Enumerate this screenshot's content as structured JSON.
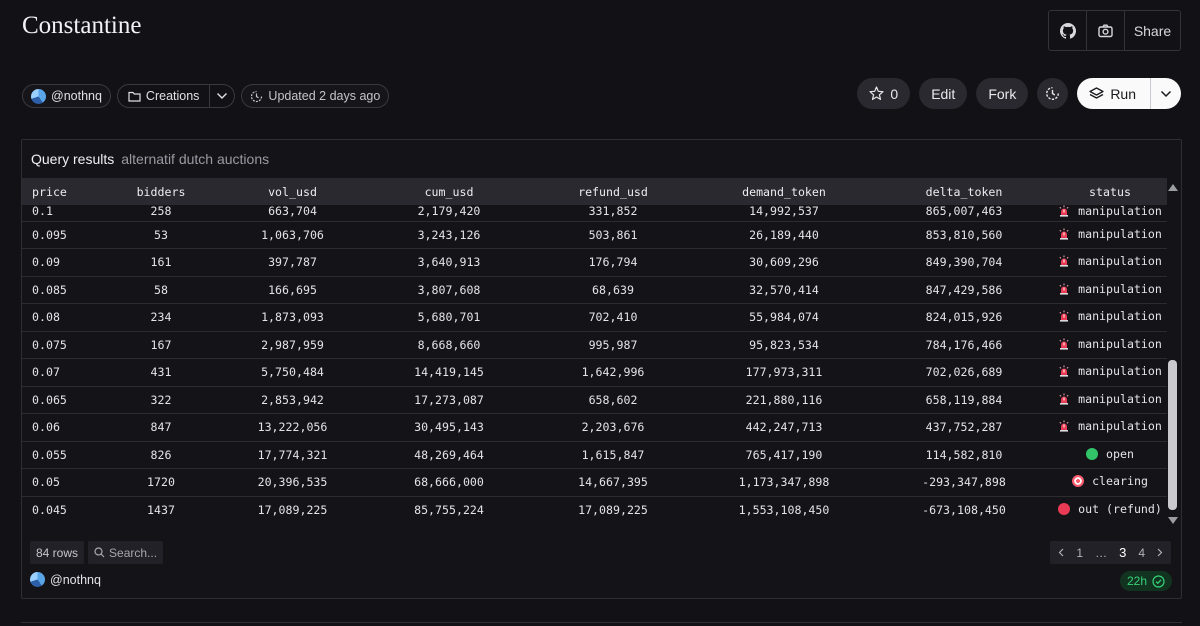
{
  "page": {
    "title": "Constantine"
  },
  "topbar": {
    "share_label": "Share",
    "github_icon": "github-icon",
    "camera_icon": "camera-icon"
  },
  "meta": {
    "author": "@nothnq",
    "folder": "Creations",
    "updated": "Updated 2 days ago"
  },
  "actions": {
    "star_count": "0",
    "edit_label": "Edit",
    "fork_label": "Fork",
    "run_label": "Run"
  },
  "query": {
    "heading": "Query results",
    "name": "alternatif dutch auctions"
  },
  "table": {
    "columns": [
      "price",
      "bidders",
      "vol_usd",
      "cum_usd",
      "refund_usd",
      "demand_token",
      "delta_token",
      "status"
    ],
    "rows": [
      [
        "0.1",
        "258",
        "663,704",
        "2,179,420",
        "331,852",
        "14,992,537",
        "865,007,463",
        "manipulation"
      ],
      [
        "0.095",
        "53",
        "1,063,706",
        "3,243,126",
        "503,861",
        "26,189,440",
        "853,810,560",
        "manipulation"
      ],
      [
        "0.09",
        "161",
        "397,787",
        "3,640,913",
        "176,794",
        "30,609,296",
        "849,390,704",
        "manipulation"
      ],
      [
        "0.085",
        "58",
        "166,695",
        "3,807,608",
        "68,639",
        "32,570,414",
        "847,429,586",
        "manipulation"
      ],
      [
        "0.08",
        "234",
        "1,873,093",
        "5,680,701",
        "702,410",
        "55,984,074",
        "824,015,926",
        "manipulation"
      ],
      [
        "0.075",
        "167",
        "2,987,959",
        "8,668,660",
        "995,987",
        "95,823,534",
        "784,176,466",
        "manipulation"
      ],
      [
        "0.07",
        "431",
        "5,750,484",
        "14,419,145",
        "1,642,996",
        "177,973,311",
        "702,026,689",
        "manipulation"
      ],
      [
        "0.065",
        "322",
        "2,853,942",
        "17,273,087",
        "658,602",
        "221,880,116",
        "658,119,884",
        "manipulation"
      ],
      [
        "0.06",
        "847",
        "13,222,056",
        "30,495,143",
        "2,203,676",
        "442,247,713",
        "437,752,287",
        "manipulation"
      ],
      [
        "0.055",
        "826",
        "17,774,321",
        "48,269,464",
        "1,615,847",
        "765,417,190",
        "114,582,810",
        "open"
      ],
      [
        "0.05",
        "1720",
        "20,396,535",
        "68,666,000",
        "14,667,395",
        "1,173,347,898",
        "-293,347,898",
        "clearing"
      ],
      [
        "0.045",
        "1437",
        "17,089,225",
        "85,755,224",
        "17,089,225",
        "1,553,108,450",
        "-673,108,450",
        "out (refund)"
      ]
    ],
    "status_icons": {
      "manipulation": "alarm-light-icon",
      "open": "green-circle-icon",
      "clearing": "target-icon",
      "out (refund)": "red-circle-icon"
    }
  },
  "footer": {
    "row_count": "84 rows",
    "search_placeholder": "Search...",
    "pages": [
      "1",
      "…",
      "3",
      "4"
    ],
    "current_page": "3",
    "author": "@nothnq",
    "age_badge": "22h"
  },
  "colors": {
    "background": "#121116",
    "accent_green": "#36d27a",
    "status_green": "#33c46a",
    "status_red": "#ea3b55"
  }
}
